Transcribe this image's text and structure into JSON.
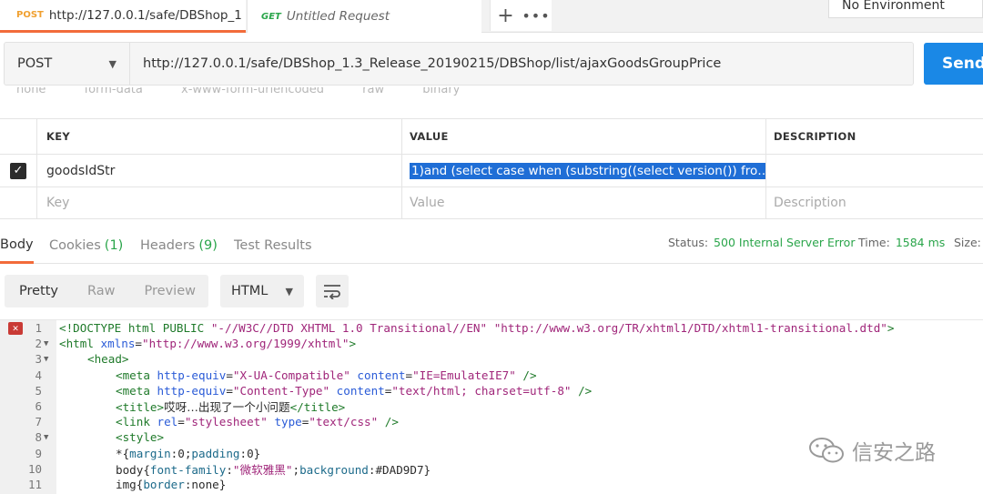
{
  "tabs": [
    {
      "method": "POST",
      "title": "http://127.0.0.1/safe/DBShop_1",
      "unsaved": true
    },
    {
      "method": "GET",
      "title": "Untitled Request"
    }
  ],
  "tab_actions": {
    "new": "+",
    "more": "•••"
  },
  "environment": {
    "selected": "No Environment"
  },
  "request": {
    "method": "POST",
    "url": "http://127.0.0.1/safe/DBShop_1.3_Release_20190215/DBShop/list/ajaxGoodsGroupPrice",
    "send_label": "Send"
  },
  "body_types": [
    "none",
    "form-data",
    "x-www-form-urlencoded",
    "raw",
    "binary"
  ],
  "params": {
    "headers": {
      "key": "KEY",
      "value": "VALUE",
      "description": "DESCRIPTION"
    },
    "rows": [
      {
        "checked": true,
        "key": "goodsIdStr",
        "value": "1)and (select case when (substring((select version()) fro…",
        "description": ""
      }
    ],
    "placeholder": {
      "key": "Key",
      "value": "Value",
      "description": "Description"
    }
  },
  "response": {
    "tabs": [
      {
        "label": "Body",
        "count": "",
        "active": true
      },
      {
        "label": "Cookies",
        "count": "(1)"
      },
      {
        "label": "Headers",
        "count": "(9)"
      },
      {
        "label": "Test Results",
        "count": ""
      }
    ],
    "status_label": "Status:",
    "status_value": "500 Internal Server Error",
    "time_label": "Time:",
    "time_value": "1584 ms",
    "size_label": "Size:"
  },
  "view_modes": [
    "Pretty",
    "Raw",
    "Preview"
  ],
  "format": "HTML",
  "code_lines": [
    {
      "n": "1",
      "error": true
    },
    {
      "n": "2",
      "fold": true
    },
    {
      "n": "3",
      "fold": true
    },
    {
      "n": "4"
    },
    {
      "n": "5"
    },
    {
      "n": "6"
    },
    {
      "n": "7"
    },
    {
      "n": "8",
      "fold": true
    },
    {
      "n": "9"
    },
    {
      "n": "10"
    },
    {
      "n": "11"
    }
  ],
  "code_text": {
    "l1": [
      "<!DOCTYPE html PUBLIC ",
      "\"-//W3C//DTD XHTML 1.0 Transitional//EN\"",
      " ",
      "\"http://www.w3.org/TR/xhtml1/DTD/xhtml1-transitional.dtd\"",
      ">"
    ],
    "l2": [
      "<html ",
      "xmlns",
      "=",
      "\"http://www.w3.org/1999/xhtml\"",
      ">"
    ],
    "l3": [
      "<head>"
    ],
    "l4": [
      "<meta ",
      "http-equiv",
      "=",
      "\"X-UA-Compatible\"",
      " ",
      "content",
      "=",
      "\"IE=EmulateIE7\"",
      " />"
    ],
    "l5": [
      "<meta ",
      "http-equiv",
      "=",
      "\"Content-Type\"",
      " ",
      "content",
      "=",
      "\"text/html; charset=utf-8\"",
      " />"
    ],
    "l6": [
      "<title>",
      "哎呀…出现了一个小问题",
      "</title>"
    ],
    "l7": [
      "<link ",
      "rel",
      "=",
      "\"stylesheet\"",
      " ",
      "type",
      "=",
      "\"text/css\"",
      " />"
    ],
    "l8": [
      "<style>"
    ],
    "l9": [
      "*{",
      "margin",
      ":0;",
      "padding",
      ":0}"
    ],
    "l10": [
      "body{",
      "font-family",
      ":",
      "\"微软雅黑\"",
      ";",
      "background",
      ":#DAD9D7}"
    ],
    "l11": [
      "img{",
      "border",
      ":none}"
    ]
  },
  "watermark": "信安之路"
}
